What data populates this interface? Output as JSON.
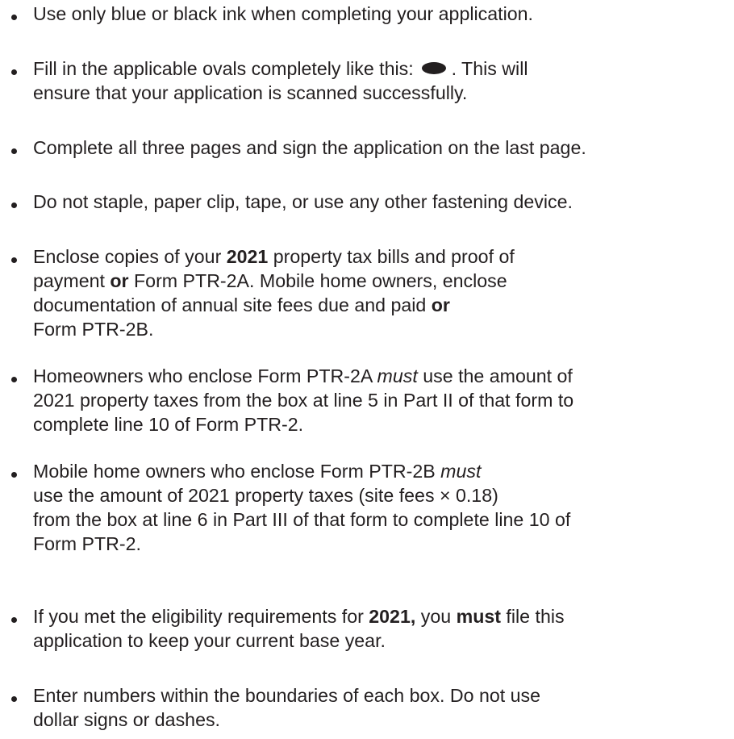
{
  "instructions": [
    {
      "lines": [
        [
          {
            "t": "Use only blue or black ink when completing your application."
          }
        ]
      ]
    },
    {
      "lines": [
        [
          {
            "t": "Fill in the applicable ovals completely like this: "
          },
          {
            "oval": true,
            "icon": "filled-oval-icon"
          },
          {
            "t": " . This will"
          }
        ],
        [
          {
            "t": "ensure that your application is scanned successfully."
          }
        ]
      ]
    },
    {
      "lines": [
        [
          {
            "t": "Complete all three pages and sign the application on the last page."
          }
        ]
      ]
    },
    {
      "lines": [
        [
          {
            "t": "Do not staple, paper clip, tape, or use any other fastening device."
          }
        ]
      ]
    },
    {
      "lines": [
        [
          {
            "t": "Enclose copies of your "
          },
          {
            "t": "2021",
            "b": true
          },
          {
            "t": " property tax bills and proof of"
          }
        ],
        [
          {
            "t": "payment "
          },
          {
            "t": "or",
            "b": true
          },
          {
            "t": " Form PTR-2A. Mobile home owners, enclose"
          }
        ],
        [
          {
            "t": "documentation of annual site fees due and paid "
          },
          {
            "t": "or",
            "b": true
          }
        ],
        [
          {
            "t": "Form PTR-2B."
          }
        ]
      ]
    },
    {
      "lines": [
        [
          {
            "t": "Homeowners who enclose Form PTR-2A "
          },
          {
            "t": "must",
            "i": true
          },
          {
            "t": " use the amount of"
          }
        ],
        [
          {
            "t": "2021 property taxes from the box at line 5 in Part II of that form to"
          }
        ],
        [
          {
            "t": "complete line 10 of Form PTR-2."
          }
        ]
      ]
    },
    {
      "lines": [
        [
          {
            "t": "Mobile home owners who enclose Form PTR-2B "
          },
          {
            "t": "must",
            "i": true
          }
        ],
        [
          {
            "t": "use the amount of 2021 property taxes (site fees × 0.18)"
          }
        ],
        [
          {
            "t": "from the box at line 6 in Part III of that form to complete line 10 of"
          }
        ],
        [
          {
            "t": "Form PTR-2."
          }
        ]
      ]
    },
    {
      "lines": [
        [
          {
            "t": "If you met the eligibility requirements for "
          },
          {
            "t": "2021,",
            "b": true
          },
          {
            "t": " you "
          },
          {
            "t": "must",
            "b": true
          },
          {
            "t": " file this"
          }
        ],
        [
          {
            "t": "application to keep your current base year."
          }
        ]
      ]
    },
    {
      "lines": [
        [
          {
            "t": "Enter numbers within the boundaries of each box. Do not use"
          }
        ],
        [
          {
            "t": "dollar signs or dashes."
          }
        ]
      ]
    }
  ]
}
